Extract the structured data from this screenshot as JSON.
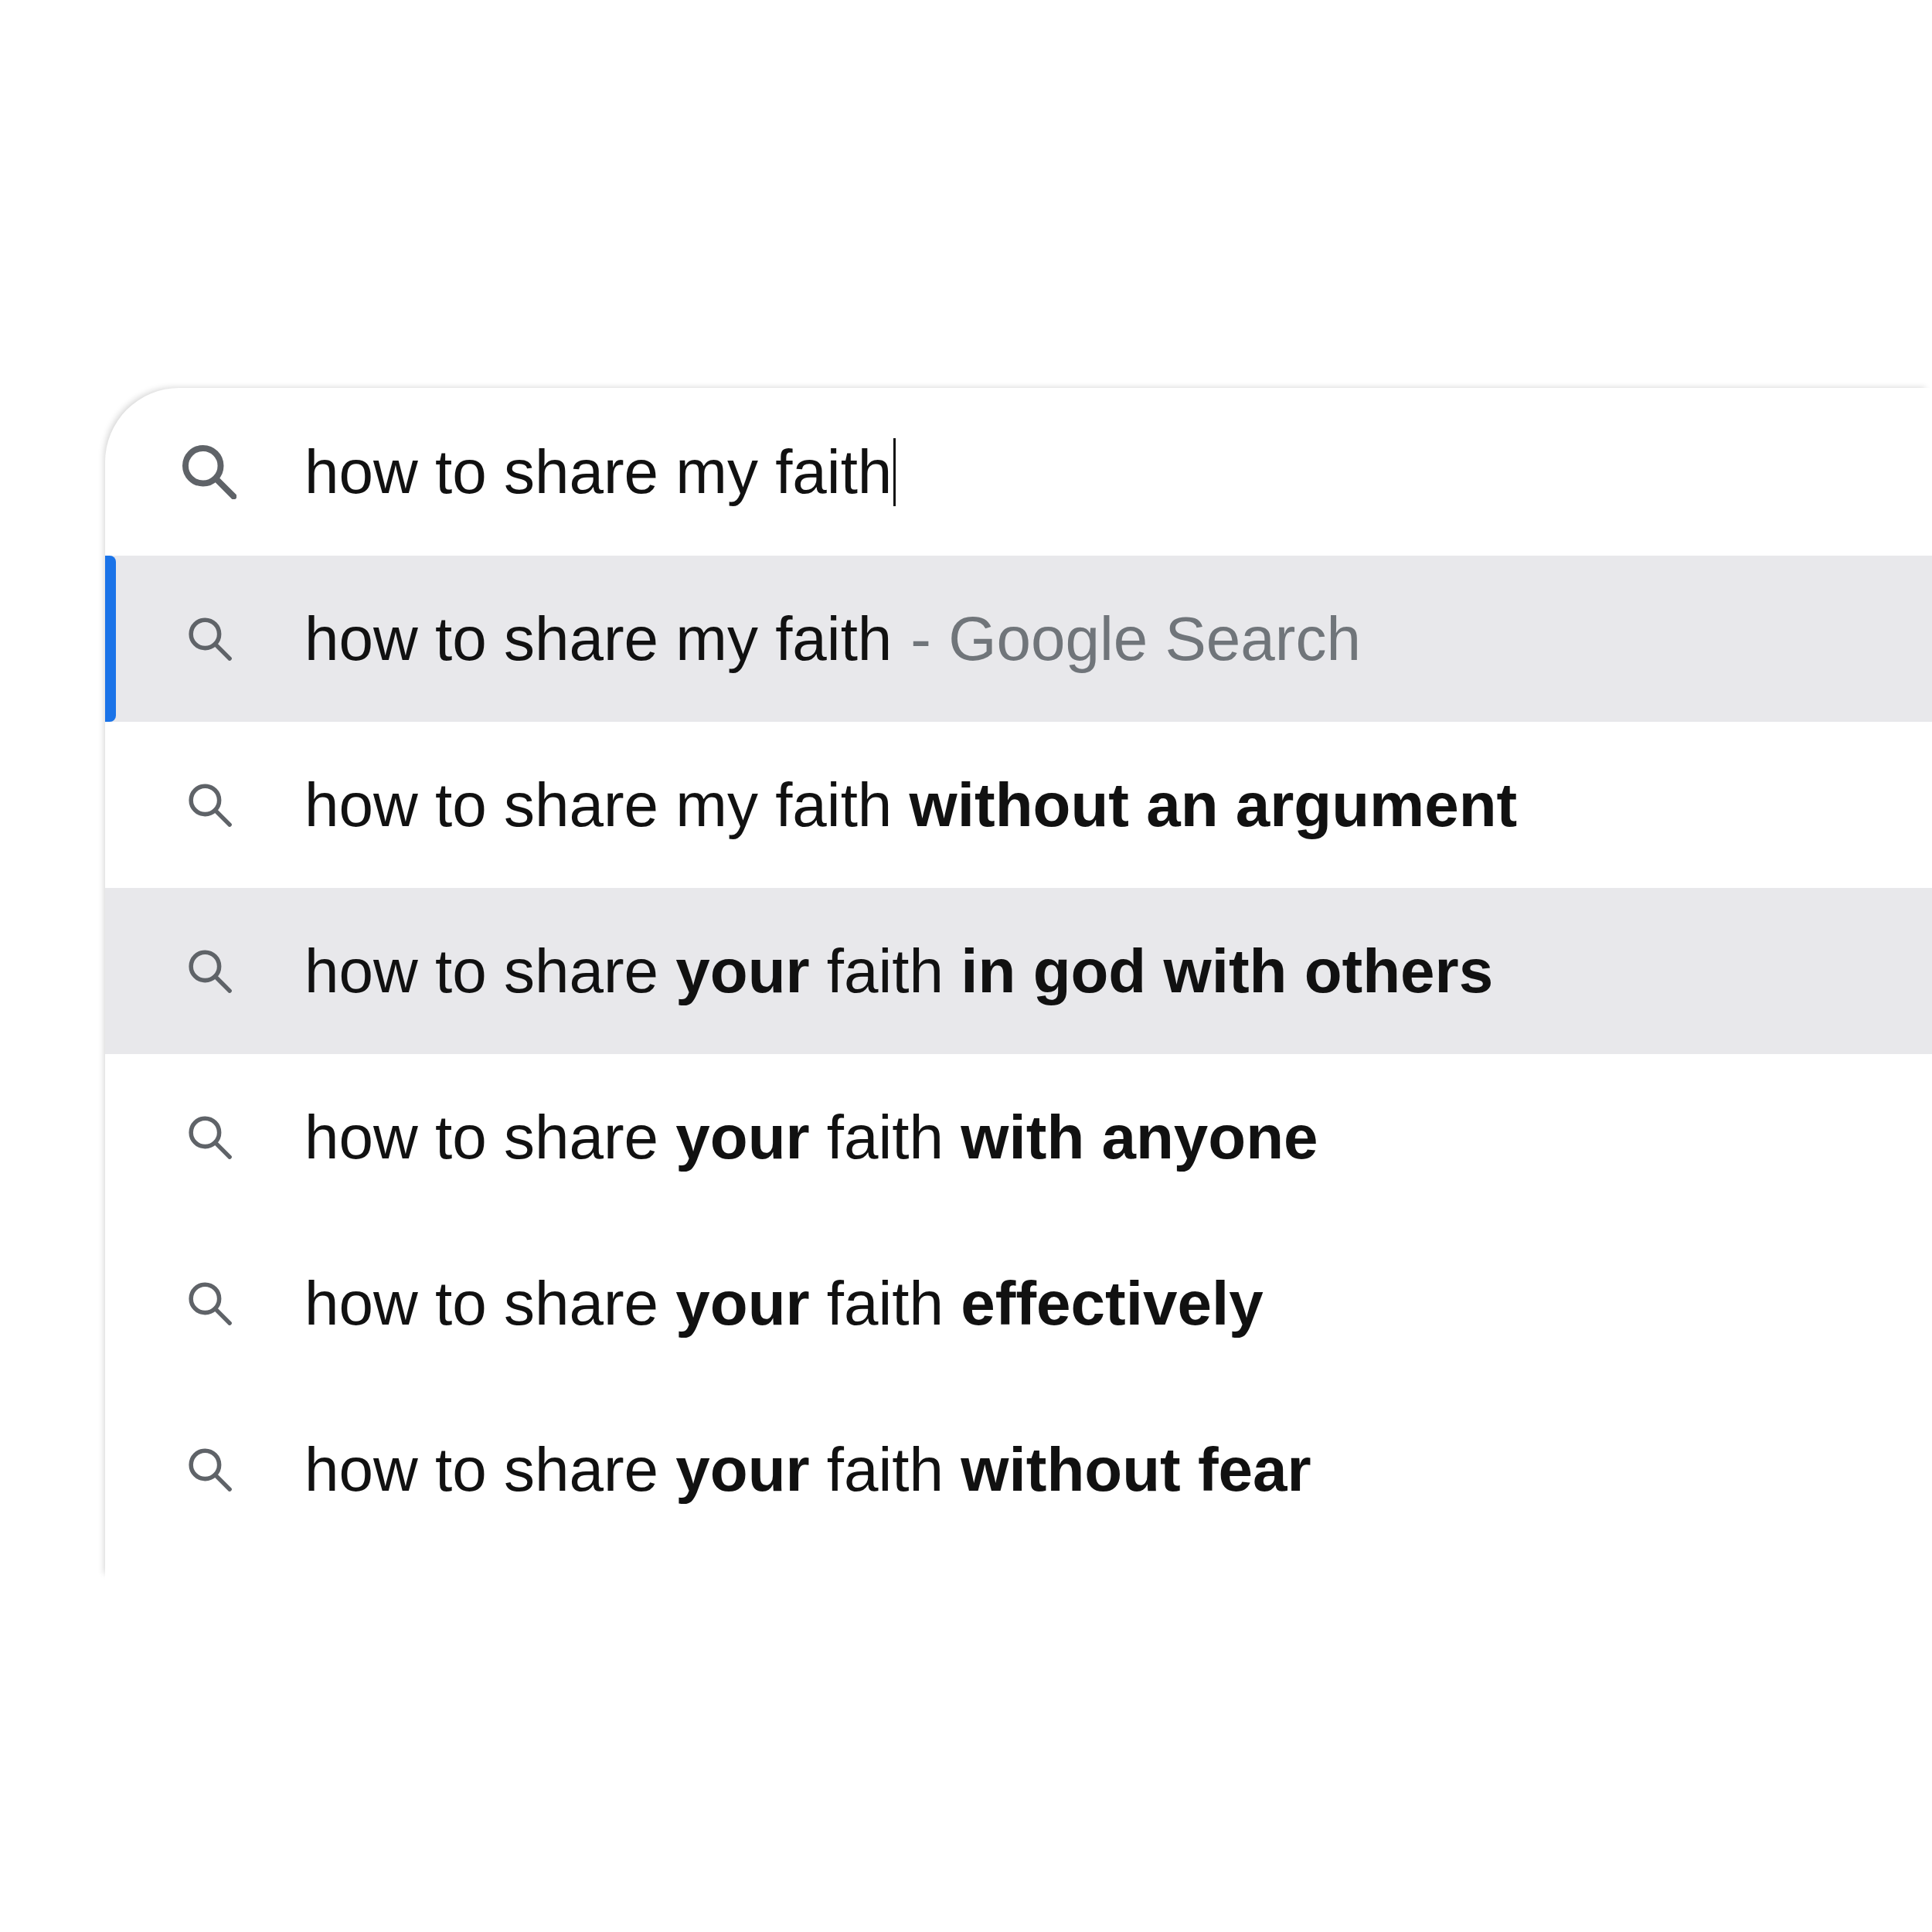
{
  "search_box": {
    "value": "how to share my faith",
    "focused": true
  },
  "suggestions": [
    {
      "text": "how to share my faith",
      "suffix": "- Google Search",
      "selected": true,
      "hovered": false
    },
    {
      "text": "how to share my faith **without an argument**",
      "selected": false,
      "hovered": false
    },
    {
      "text": "how to share **your** faith **in god with others**",
      "selected": false,
      "hovered": true
    },
    {
      "text": "how to share **your** faith **with anyone**",
      "selected": false,
      "hovered": false
    },
    {
      "text": "how to share **your** faith **effectively**",
      "selected": false,
      "hovered": false
    },
    {
      "text": "how to share **your** faith **without fear**",
      "selected": false,
      "hovered": false
    }
  ]
}
